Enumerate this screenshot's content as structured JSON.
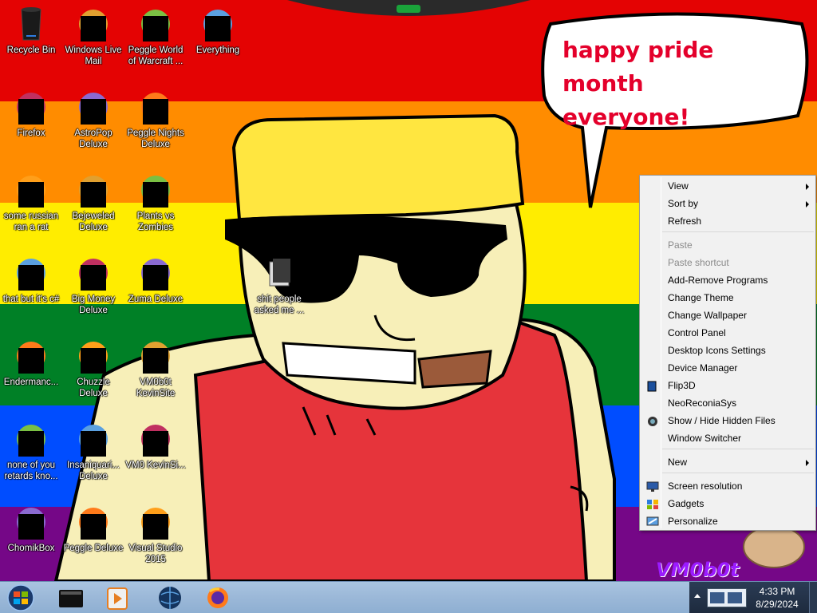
{
  "desktop": {
    "speech_bubble": "happy pride month everyone!",
    "watermark": "VM0b0t",
    "icons": [
      {
        "label": "Recycle Bin",
        "icon": "recycle-bin-icon"
      },
      {
        "label": "Windows Live Mail",
        "icon": "mail-icon"
      },
      {
        "label": "Peggle World of Warcraft ...",
        "icon": "game-icon"
      },
      {
        "label": "Everything",
        "icon": "search-icon"
      },
      {
        "label": "Firefox",
        "icon": "firefox-icon"
      },
      {
        "label": "AstroPop Deluxe",
        "icon": "game-icon"
      },
      {
        "label": "Peggle Nights Deluxe",
        "icon": "game-icon"
      },
      {
        "label": "some russian ran a rat",
        "icon": "app-icon"
      },
      {
        "label": "Bejeweled Deluxe",
        "icon": "gem-icon"
      },
      {
        "label": "Plants vs Zombies",
        "icon": "game-icon"
      },
      {
        "label": "that but it's c#",
        "icon": "app-icon"
      },
      {
        "label": "Big Money Deluxe",
        "icon": "money-bag-icon"
      },
      {
        "label": "Zuma Deluxe",
        "icon": "game-icon"
      },
      {
        "label": "Endermanc...",
        "icon": "app-icon"
      },
      {
        "label": "Chuzzle Deluxe",
        "icon": "game-icon"
      },
      {
        "label": "VM0b0t KevinSite",
        "icon": "app-icon"
      },
      {
        "label": "none of you retards kno...",
        "icon": "app-icon"
      },
      {
        "label": "Insaniquari... Deluxe",
        "icon": "fish-icon"
      },
      {
        "label": "VM0 KevinSi...",
        "icon": "app-icon"
      },
      {
        "label": "ChomikBox",
        "icon": "hamster-icon"
      },
      {
        "label": "Peggle Deluxe",
        "icon": "game-icon"
      },
      {
        "label": "Visual Studio 2015",
        "icon": "visual-studio-icon"
      },
      {
        "label": "shit people asked me ...",
        "icon": "folder-icon"
      }
    ]
  },
  "context_menu": {
    "items": [
      {
        "label": "View",
        "submenu": true,
        "disabled": false
      },
      {
        "label": "Sort by",
        "submenu": true,
        "disabled": false
      },
      {
        "label": "Refresh",
        "submenu": false,
        "disabled": false
      },
      {
        "label": "Paste",
        "submenu": false,
        "disabled": true
      },
      {
        "label": "Paste shortcut",
        "submenu": false,
        "disabled": true
      },
      {
        "label": "Add-Remove Programs",
        "submenu": false,
        "disabled": false
      },
      {
        "label": "Change Theme",
        "submenu": false,
        "disabled": false
      },
      {
        "label": "Change Wallpaper",
        "submenu": false,
        "disabled": false
      },
      {
        "label": "Control Panel",
        "submenu": false,
        "disabled": false
      },
      {
        "label": "Desktop Icons Settings",
        "submenu": false,
        "disabled": false
      },
      {
        "label": "Device Manager",
        "submenu": false,
        "disabled": false
      },
      {
        "label": "Flip3D",
        "submenu": false,
        "disabled": false,
        "icon": "flip3d-icon"
      },
      {
        "label": "NeoReconiaSys",
        "submenu": false,
        "disabled": false
      },
      {
        "label": "Show / Hide Hidden Files",
        "submenu": false,
        "disabled": false,
        "icon": "hidden-files-icon"
      },
      {
        "label": "Window Switcher",
        "submenu": false,
        "disabled": false
      },
      {
        "label": "New",
        "submenu": true,
        "disabled": false
      },
      {
        "label": "Screen resolution",
        "submenu": false,
        "disabled": false,
        "icon": "display-icon"
      },
      {
        "label": "Gadgets",
        "submenu": false,
        "disabled": false,
        "icon": "gadgets-icon"
      },
      {
        "label": "Personalize",
        "submenu": false,
        "disabled": false,
        "icon": "personalize-icon"
      }
    ]
  },
  "taskbar": {
    "pinned": [
      "terminal-icon",
      "media-player-icon",
      "globe-icon",
      "firefox-icon"
    ],
    "clock": {
      "time": "4:33 PM",
      "date": "8/29/2024"
    }
  },
  "colors": {
    "pride": [
      "#e40303",
      "#ff8c00",
      "#ffed00",
      "#008026",
      "#004dff",
      "#750787"
    ],
    "bubble_text": "#e4002b"
  }
}
